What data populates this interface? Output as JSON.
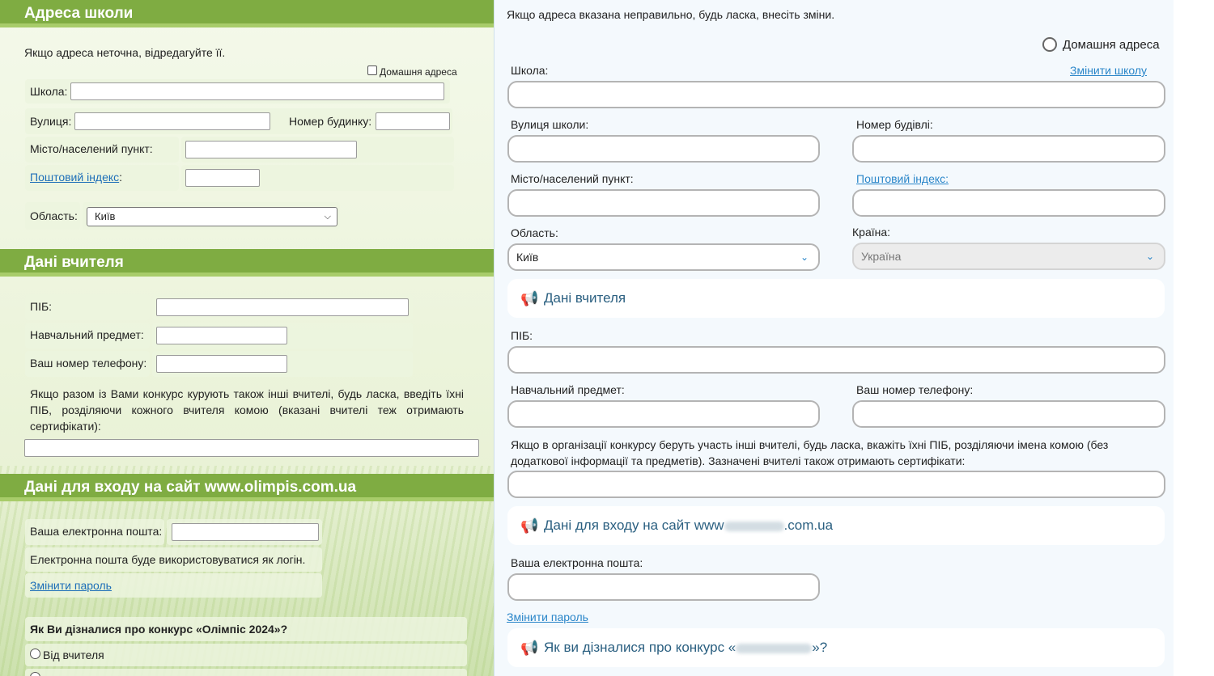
{
  "left": {
    "school_address": {
      "title": "Адреса школи",
      "hint": "Якщо адреса неточна, відредагуйте її.",
      "home_address_label": "Домашня адреса",
      "school_label": "Школа:",
      "street_label": "Вулиця:",
      "house_label": "Номер будинку:",
      "city_label": "Місто/населений пункт:",
      "postcode_label": "Поштовий індекс",
      "postcode_colon": ":",
      "region_label": "Область:",
      "region_value": "Київ"
    },
    "teacher": {
      "title": "Дані вчителя",
      "name_label": "ПІБ:",
      "subject_label": "Навчальний предмет:",
      "phone_label": "Ваш номер телефону:",
      "others_hint": "Якщо разом із Вами конкурс курують також інші вчителі, будь ласка, введіть їхні ПІБ, розділяючи кожного вчителя комою (вказані вчителі теж отримають сертифікати):"
    },
    "login": {
      "title": "Дані для входу на сайт www.olimpis.com.ua",
      "email_label": "Ваша електронна пошта:",
      "email_note": "Електронна пошта буде використовуватися як логін.",
      "change_password": "Змінити пароль"
    },
    "survey": {
      "question": "Як Ви дізналися про конкурс «Олімпіс 2024»?",
      "option_1": "Від вчителя"
    }
  },
  "right": {
    "intro": "Якщо адреса вказана неправильно, будь ласка, внесіть зміни.",
    "home_address_label": "Домашня адреса",
    "school_label": "Школа:",
    "change_school": "Змінити школу",
    "street_label": "Вулиця школи:",
    "building_label": "Номер будівлі:",
    "city_label": "Місто/населений пункт:",
    "postcode_label": "Поштовий індекс:",
    "region_label": "Область:",
    "region_value": "Київ",
    "country_label": "Країна:",
    "country_value": "Україна",
    "teacher_title": "Дані вчителя",
    "name_label": "ПІБ:",
    "subject_label": "Навчальний предмет:",
    "phone_label": "Ваш номер телефону:",
    "others_hint": "Якщо в організації конкурсу беруть участь інші вчителі, будь ласка, вкажіть їхні ПІБ, розділяючи імена комою (без додаткової інформації та предметів). Зазначені вчителі також отримають сертифікати:",
    "login_title_prefix": "Дані для входу на сайт www",
    "login_title_suffix": ".com.ua",
    "email_label": "Ваша електронна пошта:",
    "change_password": "Змінити пароль",
    "survey_prefix": "Як ви дізналися про конкурс «",
    "survey_suffix": "»?"
  },
  "icons": {
    "section_icon": "megaphone-icon",
    "select_arrow": "chevron-down-icon"
  },
  "colors": {
    "left_header": "#7fac42",
    "right_accent": "#2a86c9",
    "link": "#1e6fb8"
  }
}
